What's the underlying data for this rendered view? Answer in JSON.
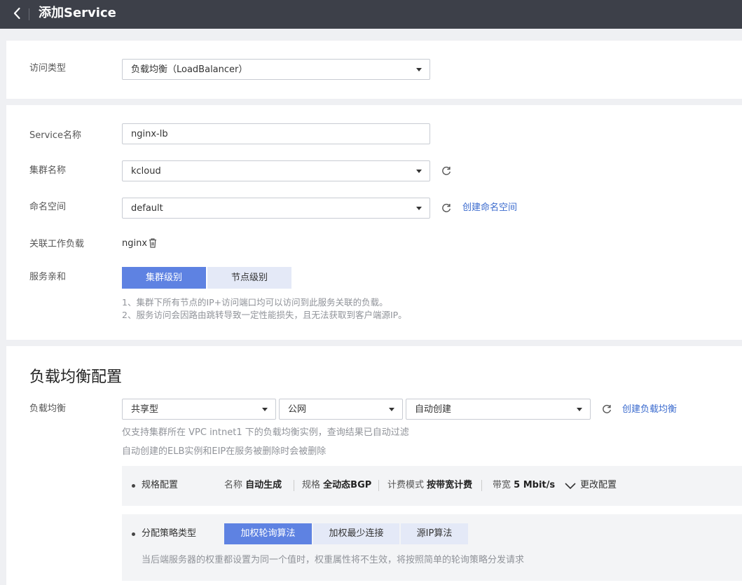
{
  "header": {
    "title": "添加Service"
  },
  "access": {
    "label": "访问类型",
    "value": "负载均衡（LoadBalancer）"
  },
  "form": {
    "service_name_label": "Service名称",
    "service_name_value": "nginx-lb",
    "cluster_label": "集群名称",
    "cluster_value": "kcloud",
    "namespace_label": "命名空间",
    "namespace_value": "default",
    "create_namespace_link": "创建命名空间",
    "workload_label": "关联工作负载",
    "workload_value": "nginx",
    "affinity_label": "服务亲和",
    "affinity_options": [
      "集群级别",
      "节点级别"
    ],
    "affinity_selected": "集群级别",
    "affinity_hint1": "1、集群下所有节点的IP+访问端口均可以访问到此服务关联的负载。",
    "affinity_hint2": "2、服务访问会因路由跳转导致一定性能损失，且无法获取到客户端源IP。"
  },
  "lb": {
    "section_title": "负载均衡配置",
    "label": "负载均衡",
    "type_value": "共享型",
    "network_value": "公网",
    "instance_value": "自动创建",
    "create_link": "创建负载均衡",
    "hint1": "仅支持集群所在 VPC intnet1 下的负载均衡实例，查询结果已自动过滤",
    "hint2": "自动创建的ELB实例和EIP在服务被删除时会被删除",
    "spec": {
      "label": "规格配置",
      "name_key": "名称",
      "name_val": "自动生成",
      "spec_key": "规格",
      "spec_val": "全动态BGP",
      "billing_key": "计费模式",
      "billing_val": "按带宽计费",
      "bw_key": "带宽",
      "bw_val": "5 Mbit/s",
      "change_link": "更改配置"
    },
    "policy": {
      "label": "分配策略类型",
      "options": [
        "加权轮询算法",
        "加权最少连接",
        "源IP算法"
      ],
      "selected": "加权轮询算法",
      "hint": "当后端服务器的权重都设置为同一个值时，权重属性将不生效，将按照简单的轮询策略分发请求"
    }
  },
  "colors": {
    "accent": "#5e82e2",
    "link": "#3b6bce",
    "topbar": "#3d4049"
  }
}
